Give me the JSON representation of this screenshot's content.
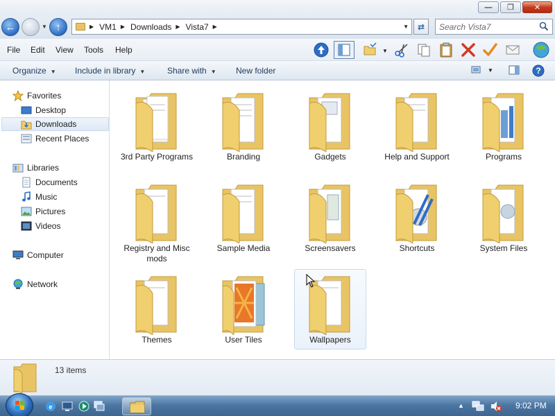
{
  "window": {
    "buttons": [
      "minimize",
      "maximize",
      "close"
    ]
  },
  "address": {
    "crumbs": [
      "VM1",
      "Downloads",
      "Vista7"
    ]
  },
  "search": {
    "placeholder": "Search Vista7"
  },
  "menu": {
    "items": [
      "File",
      "Edit",
      "View",
      "Tools",
      "Help"
    ]
  },
  "commands": {
    "organize": "Organize",
    "include_in_library": "Include in library",
    "share_with": "Share with",
    "new_folder": "New folder"
  },
  "sidebar": {
    "favorites": {
      "label": "Favorites",
      "items": [
        "Desktop",
        "Downloads",
        "Recent Places"
      ],
      "selected": "Downloads"
    },
    "libraries": {
      "label": "Libraries",
      "items": [
        "Documents",
        "Music",
        "Pictures",
        "Videos"
      ]
    },
    "computer": "Computer",
    "network": "Network"
  },
  "folders": [
    "3rd Party Programs",
    "Branding",
    "Gadgets",
    "Help and Support",
    "Programs",
    "Registry and Misc mods",
    "Sample Media",
    "Screensavers",
    "Shortcuts",
    "System Files",
    "Themes",
    "User Tiles",
    "Wallpapers"
  ],
  "hovered_folder": "Wallpapers",
  "status": {
    "item_count": "13 items"
  },
  "taskbar": {
    "clock": "9:02 PM"
  },
  "colors": {
    "folder": "#f0cf6e",
    "accent": "#2d6dc4"
  }
}
